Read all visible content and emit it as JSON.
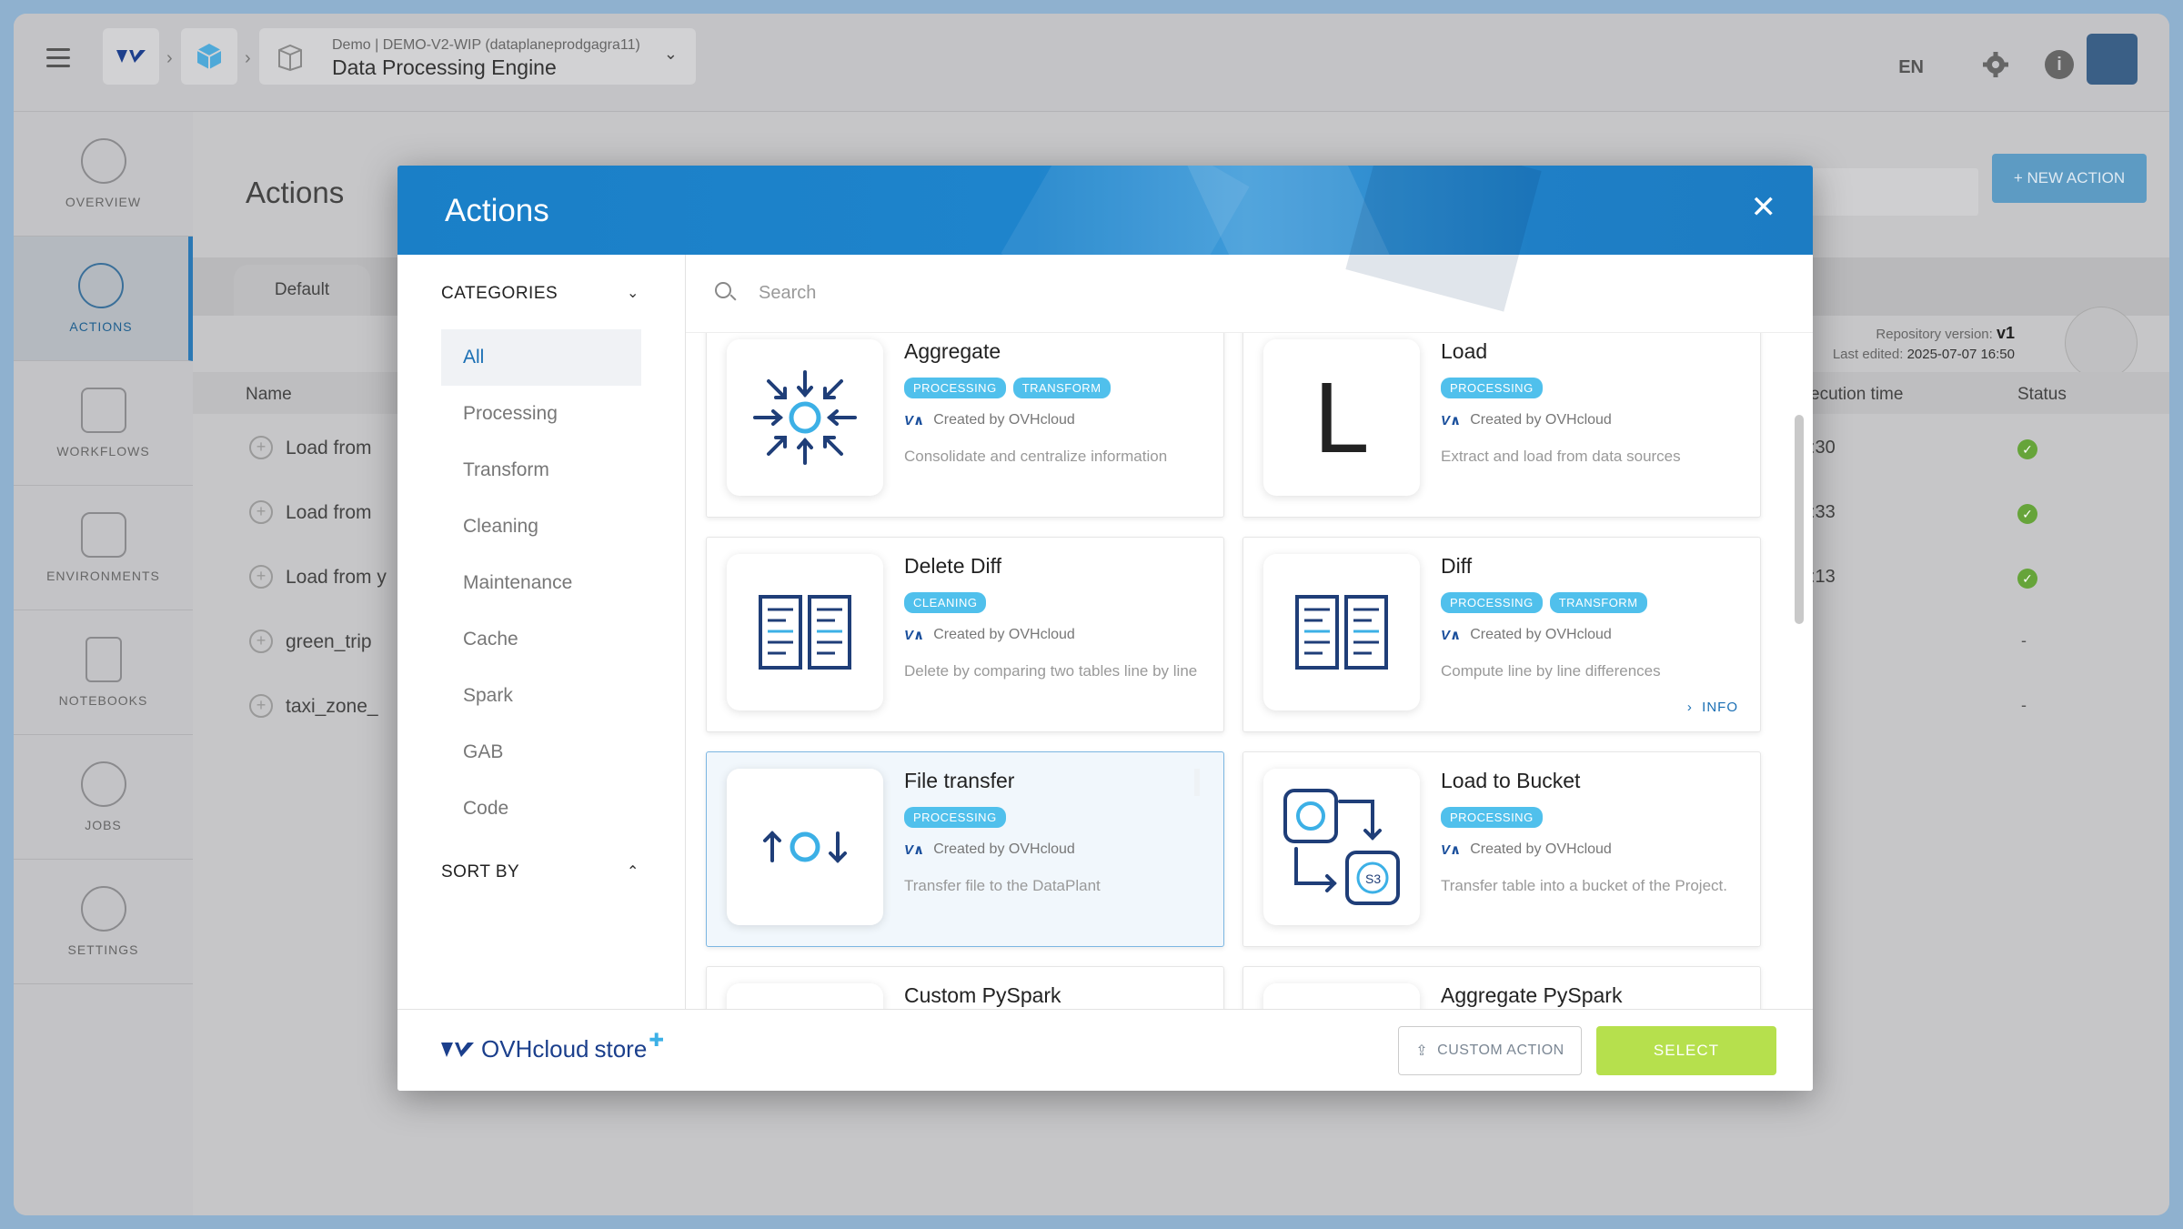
{
  "topbar": {
    "project_sub": "Demo | DEMO-V2-WIP (dataplaneprodgagra11)",
    "project_title": "Data Processing Engine",
    "lang": "EN"
  },
  "sidebar": {
    "items": [
      {
        "label": "OVERVIEW",
        "icon": "dashboard-icon"
      },
      {
        "label": "ACTIONS",
        "icon": "target-icon"
      },
      {
        "label": "WORKFLOWS",
        "icon": "workflow-icon"
      },
      {
        "label": "ENVIRONMENTS",
        "icon": "cube-icon"
      },
      {
        "label": "NOTEBOOKS",
        "icon": "notebook-icon"
      },
      {
        "label": "JOBS",
        "icon": "jobs-icon"
      },
      {
        "label": "SETTINGS",
        "icon": "gear-icon"
      }
    ]
  },
  "page": {
    "title": "Actions",
    "new_action": "+ NEW ACTION",
    "tab_default": "Default",
    "repo_version_label": "Repository version:",
    "repo_version": "v1",
    "last_edited_label": "Last edited:",
    "last_edited": "2025-07-07 16:50",
    "columns": {
      "name": "Name",
      "exec_time": "ecution time",
      "status": "Status"
    },
    "rows": [
      {
        "name": "Load from",
        "time": ":30",
        "status": "ok"
      },
      {
        "name": "Load from",
        "time": ":33",
        "status": "ok"
      },
      {
        "name": "Load from y",
        "time": ":13",
        "status": "ok"
      },
      {
        "name": "green_trip",
        "time": "",
        "status": "-"
      },
      {
        "name": "taxi_zone_",
        "time": "",
        "status": "-"
      }
    ]
  },
  "modal": {
    "title": "Actions",
    "close": "✕",
    "categories_label": "CATEGORIES",
    "sort_label": "SORT BY",
    "categories": [
      "All",
      "Processing",
      "Transform",
      "Cleaning",
      "Maintenance",
      "Cache",
      "Spark",
      "GAB",
      "Code"
    ],
    "search_placeholder": "Search",
    "cards": [
      {
        "title": "Aggregate",
        "tags": [
          "PROCESSING",
          "TRANSFORM"
        ],
        "creator": "Created by OVHcloud",
        "desc": "Consolidate and centralize information",
        "icon": "aggregate-icon"
      },
      {
        "title": "Load",
        "tags": [
          "PROCESSING"
        ],
        "creator": "Created by OVHcloud",
        "desc": "Extract and load from data sources",
        "icon": "letter-l-icon",
        "letter": "L"
      },
      {
        "title": "Delete Diff",
        "tags": [
          "CLEANING"
        ],
        "creator": "Created by OVHcloud",
        "desc": "Delete by comparing two tables line by line",
        "icon": "compare-documents-icon"
      },
      {
        "title": "Diff",
        "tags": [
          "PROCESSING",
          "TRANSFORM"
        ],
        "creator": "Created by OVHcloud",
        "desc": "Compute line by line differences",
        "icon": "compare-documents-icon",
        "info": "INFO"
      },
      {
        "title": "File transfer",
        "tags": [
          "PROCESSING"
        ],
        "creator": "Created by OVHcloud",
        "desc": "Transfer file to the DataPlant",
        "icon": "transfer-icon"
      },
      {
        "title": "Load to Bucket",
        "tags": [
          "PROCESSING"
        ],
        "creator": "Created by OVHcloud",
        "desc": "Transfer table into a bucket of the Project.",
        "icon": "bucket-icon"
      },
      {
        "title": "Custom PySpark",
        "tags": [],
        "creator": "",
        "desc": "",
        "icon": "pyspark-icon"
      },
      {
        "title": "Aggregate PySpark",
        "tags": [],
        "creator": "",
        "desc": "",
        "icon": "pyspark-icon"
      }
    ],
    "store_brand": "OVHcloud",
    "store_word": "store",
    "custom_action": "CUSTOM ACTION",
    "select": "SELECT"
  },
  "colors": {
    "accent": "#1a7fc7",
    "tag": "#50c0ec",
    "select": "#b6e04d",
    "ok": "#66a43a"
  }
}
